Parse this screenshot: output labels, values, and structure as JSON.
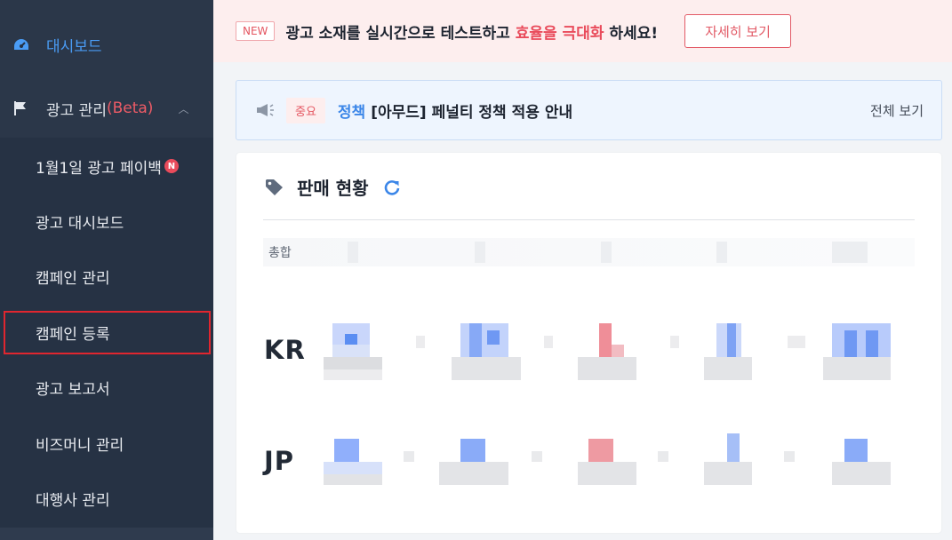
{
  "sidebar": {
    "dashboard_label": "대시보드",
    "ad_manage_label": "광고 관리",
    "ad_manage_beta": "(Beta)",
    "badge_new": "N",
    "sub_items": [
      {
        "label": "1월1일 광고 페이백"
      },
      {
        "label": "광고 대시보드"
      },
      {
        "label": "캠페인 관리"
      },
      {
        "label": "캠페인 등록"
      },
      {
        "label": "광고 보고서"
      },
      {
        "label": "비즈머니 관리"
      },
      {
        "label": "대행사 관리"
      }
    ]
  },
  "promo": {
    "tag": "NEW",
    "text_before": "광고 소재를 실시간으로 테스트하고 ",
    "text_highlight": "효율을 극대화",
    "text_after": " 하세요!",
    "button_label": "자세히 보기"
  },
  "notice": {
    "importance": "중요",
    "category": "정책",
    "title": "[아무드] 페널티 정책 적용 안내",
    "view_all": "전체 보기"
  },
  "sales": {
    "title": "판매 현황",
    "total_label": "총합",
    "regions": [
      "KR",
      "JP"
    ]
  },
  "colors": {
    "sidebar_bg": "#263244",
    "accent_blue": "#4a9cf5",
    "accent_red": "#e94b5b",
    "promo_bg": "#fdeeee",
    "notice_bg": "#eef5fe"
  },
  "icons": {
    "dashboard": "speedometer-icon",
    "ad_manage": "flag-icon",
    "notice": "megaphone-icon",
    "sales": "tag-icon",
    "refresh": "refresh-icon",
    "chevron": "chevron-up-icon"
  }
}
